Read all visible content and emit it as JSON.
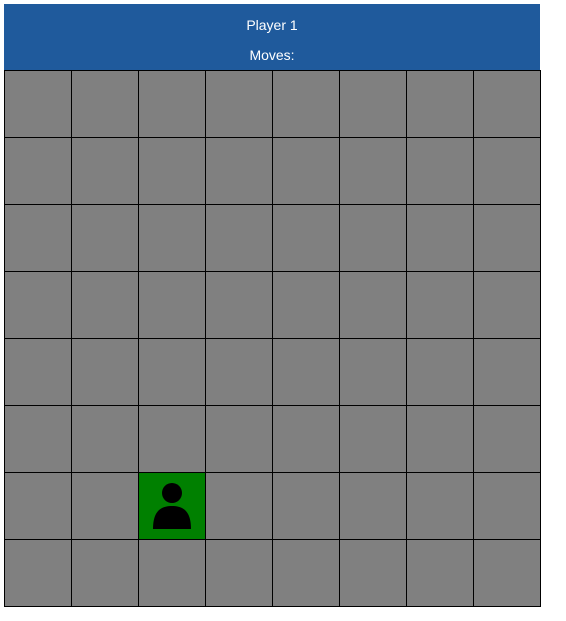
{
  "header": {
    "player_label": "Player 1",
    "moves_label": "Moves:"
  },
  "board": {
    "rows": 8,
    "cols": 8,
    "player_position": {
      "row": 6,
      "col": 2
    },
    "colors": {
      "cell": "#808080",
      "player_cell": "#008000",
      "grid_line": "#000000",
      "header": "#1f5a9c"
    },
    "player_icon": "person-icon"
  }
}
